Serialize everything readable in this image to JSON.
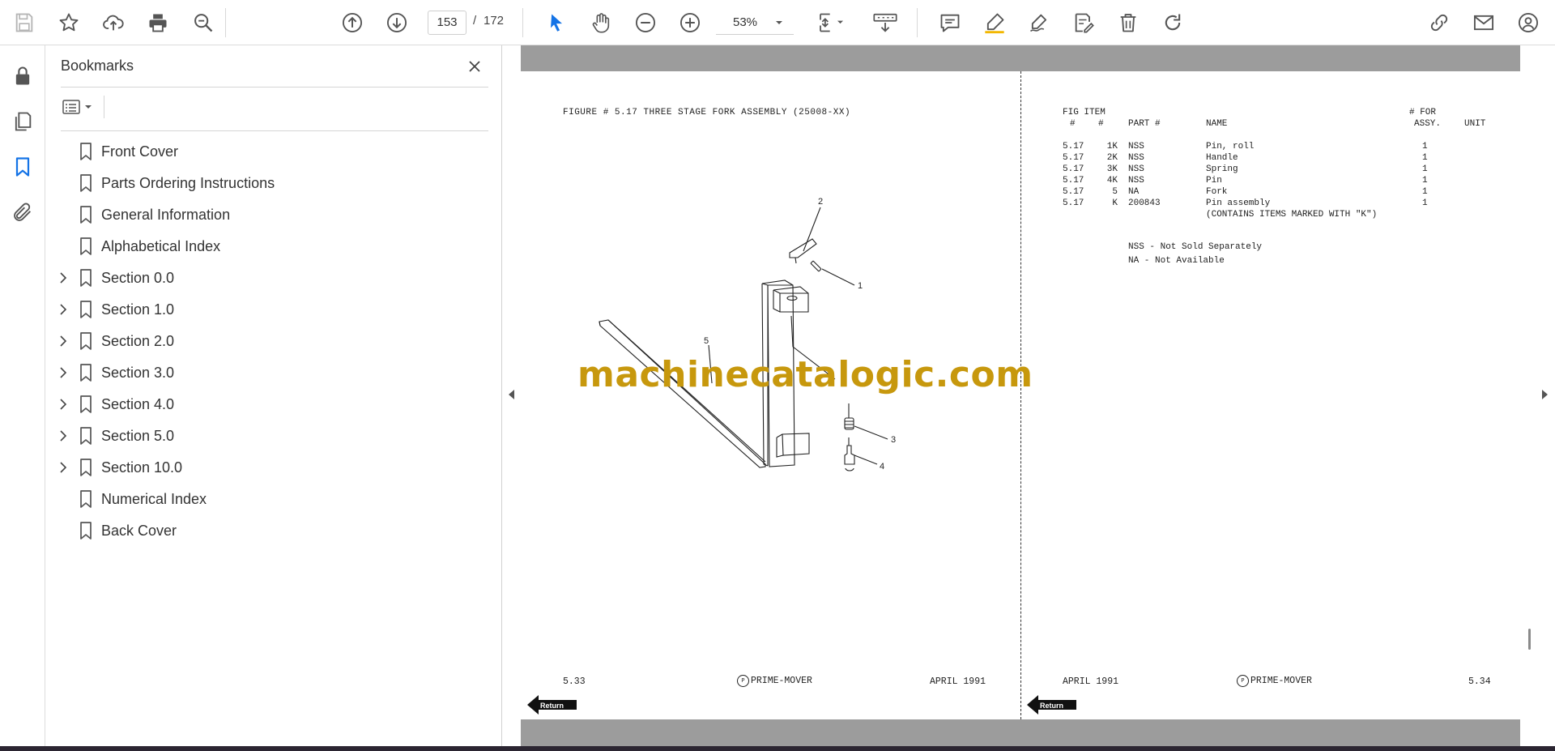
{
  "toolbar": {
    "page_current": "153",
    "page_separator": "/",
    "page_total": "172",
    "zoom": "53%"
  },
  "bookmarks_panel": {
    "title": "Bookmarks",
    "items": [
      {
        "label": "Front Cover",
        "expandable": false
      },
      {
        "label": "Parts Ordering Instructions",
        "expandable": false
      },
      {
        "label": "General Information",
        "expandable": false
      },
      {
        "label": "Alphabetical Index",
        "expandable": false
      },
      {
        "label": "Section 0.0",
        "expandable": true
      },
      {
        "label": "Section 1.0",
        "expandable": true
      },
      {
        "label": "Section 2.0",
        "expandable": true
      },
      {
        "label": "Section 3.0",
        "expandable": true
      },
      {
        "label": "Section 4.0",
        "expandable": true
      },
      {
        "label": "Section 5.0",
        "expandable": true
      },
      {
        "label": "Section 10.0",
        "expandable": true
      },
      {
        "label": "Numerical Index",
        "expandable": false
      },
      {
        "label": "Back Cover",
        "expandable": false
      }
    ]
  },
  "left_page": {
    "figure_title": "FIGURE # 5.17 THREE STAGE FORK ASSEMBLY (25008-XX)",
    "callouts": [
      "1",
      "2",
      "3",
      "4",
      "5"
    ],
    "footer_page": "5.33",
    "footer_brand": "PRIME-MOVER",
    "footer_date": "APRIL 1991",
    "return_label": "Return"
  },
  "right_page": {
    "header": {
      "fig_line1": "FIG ITEM",
      "fig_line2a": "#",
      "fig_line2b": "#",
      "part": "PART #",
      "name": "NAME",
      "for_line1": "# FOR",
      "for_line2": "ASSY.",
      "unit": "UNIT"
    },
    "rows": [
      {
        "fig": "5.17",
        "item": "1K",
        "part": "NSS",
        "name": "Pin, roll",
        "qty": "1"
      },
      {
        "fig": "5.17",
        "item": "2K",
        "part": "NSS",
        "name": "Handle",
        "qty": "1"
      },
      {
        "fig": "5.17",
        "item": "3K",
        "part": "NSS",
        "name": "Spring",
        "qty": "1"
      },
      {
        "fig": "5.17",
        "item": "4K",
        "part": "NSS",
        "name": "Pin",
        "qty": "1"
      },
      {
        "fig": "5.17",
        "item": "5",
        "part": "NA",
        "name": "Fork",
        "qty": "1"
      },
      {
        "fig": "5.17",
        "item": "K",
        "part": "200843",
        "name": "Pin assembly",
        "qty": "1"
      }
    ],
    "row_note": "(CONTAINS ITEMS MARKED WITH \"K\")",
    "legend": [
      "NSS - Not Sold Separately",
      "NA - Not Available"
    ],
    "footer_date": "APRIL 1991",
    "footer_brand": "PRIME-MOVER",
    "footer_page": "5.34",
    "return_label": "Return"
  },
  "watermark": "machinecatalogic.com",
  "colors": {
    "accent": "#1473e6",
    "watermark": "#c7980d",
    "page_gutter": "#9c9c9c"
  }
}
